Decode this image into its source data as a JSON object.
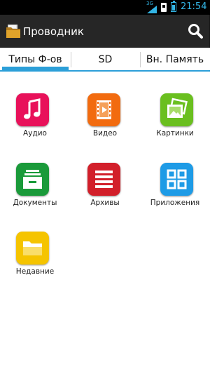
{
  "status_bar": {
    "network": "3G",
    "time": "21:54",
    "accent_color": "#33b5e5"
  },
  "action_bar": {
    "title": "Проводник",
    "app_icon": "folder-icon",
    "search_icon": "search-icon",
    "background": "#262626"
  },
  "tabs": [
    {
      "label": "Типы Ф-ов",
      "selected": true
    },
    {
      "label": "SD",
      "selected": false
    },
    {
      "label": "Вн. Память",
      "selected": false
    }
  ],
  "tab_accent": "#2c9fd8",
  "categories": [
    {
      "label": "Аудио",
      "icon": "music-note-icon",
      "color": "#e8115a"
    },
    {
      "label": "Видео",
      "icon": "film-icon",
      "color": "#f26b0f"
    },
    {
      "label": "Картинки",
      "icon": "pictures-icon",
      "color": "#6abf1f"
    },
    {
      "label": "Документы",
      "icon": "archive-box-icon",
      "color": "#1a9a3a"
    },
    {
      "label": "Архивы",
      "icon": "list-lines-icon",
      "color": "#d21f2a"
    },
    {
      "label": "Приложения",
      "icon": "apps-grid-icon",
      "color": "#1e9be6"
    },
    {
      "label": "Недавние",
      "icon": "open-folder-icon",
      "color": "#f5c400"
    }
  ]
}
